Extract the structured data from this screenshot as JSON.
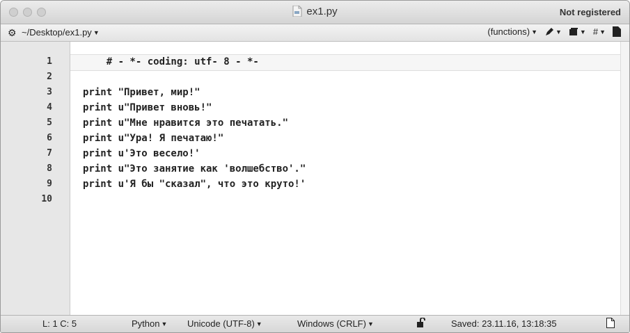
{
  "window": {
    "title": "ex1.py",
    "registration": "Not registered"
  },
  "toolbar": {
    "path": "~/Desktop/ex1.py",
    "functions_label": "(functions)",
    "hash_label": "#"
  },
  "editor": {
    "line_numbers": [
      "1",
      "2",
      "3",
      "4",
      "5",
      "6",
      "7",
      "8",
      "9",
      "10"
    ],
    "lines": [
      "    # - *- coding: utf- 8 - *-",
      "",
      "print \"Привет, мир!\"",
      "print u\"Привет вновь!\"",
      "print u\"Мне нравится это печатать.\"",
      "print u\"Ура! Я печатаю!\"",
      "print u'Это весело!'",
      "print u\"Это занятие как 'волшебство'.\"",
      "print u'Я бы \"сказал\", что это круто!'",
      ""
    ]
  },
  "status": {
    "position": "L: 1 C: 5",
    "language": "Python",
    "encoding": "Unicode (UTF-8)",
    "line_endings": "Windows (CRLF)",
    "saved": "Saved: 23.11.16, 13:18:35"
  },
  "icons": {
    "gear": "gear-icon",
    "pen": "pen-icon",
    "stack": "stack-icon",
    "doc": "document-icon",
    "lock": "unlock-icon"
  }
}
